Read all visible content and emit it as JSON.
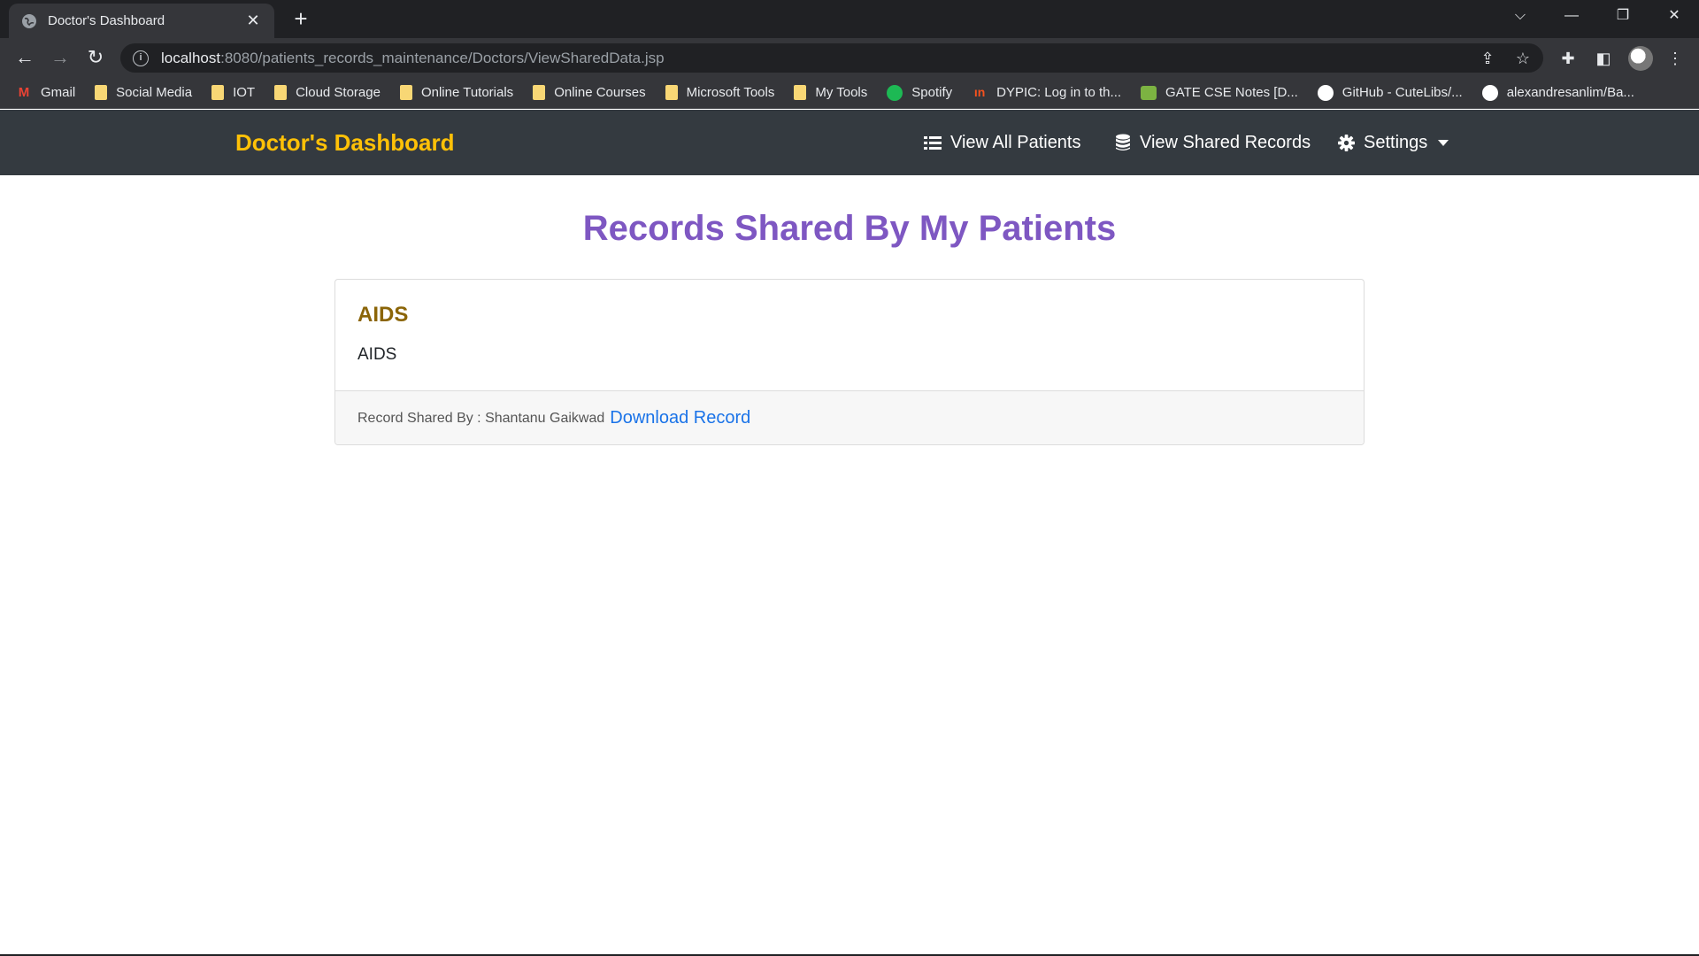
{
  "browser": {
    "tab_title": "Doctor's Dashboard",
    "url_host": "localhost",
    "url_rest": ":8080/patients_records_maintenance/Doctors/ViewSharedData.jsp",
    "bookmarks": [
      {
        "label": "Gmail",
        "icon": "gmail-icon"
      },
      {
        "label": "Social Media",
        "icon": "folder-icon"
      },
      {
        "label": "IOT",
        "icon": "folder-icon"
      },
      {
        "label": "Cloud Storage",
        "icon": "folder-icon"
      },
      {
        "label": "Online Tutorials",
        "icon": "folder-icon"
      },
      {
        "label": "Online Courses",
        "icon": "folder-icon"
      },
      {
        "label": "Microsoft Tools",
        "icon": "folder-icon"
      },
      {
        "label": "My Tools",
        "icon": "folder-icon"
      },
      {
        "label": "Spotify",
        "icon": "spotify-icon"
      },
      {
        "label": "DYPIC: Log in to th...",
        "icon": "dypic-icon"
      },
      {
        "label": "GATE CSE Notes [D...",
        "icon": "gate-icon"
      },
      {
        "label": "GitHub - CuteLibs/...",
        "icon": "github-icon"
      },
      {
        "label": "alexandresanlim/Ba...",
        "icon": "github-icon"
      }
    ]
  },
  "navbar": {
    "brand": "Doctor's Dashboard",
    "view_all_patients": "View All Patients",
    "view_shared_records": "View Shared Records",
    "settings": "Settings"
  },
  "main": {
    "title": "Records Shared By My Patients",
    "records": [
      {
        "title": "AIDS",
        "description": "AIDS",
        "shared_by_label": "Record Shared By : Shantanu Gaikwad",
        "download_label": "Download Record"
      }
    ]
  },
  "colors": {
    "brand": "#ffc107",
    "navbar_bg": "#343a40",
    "page_title": "#7e57c2",
    "card_title": "#8b6508",
    "link": "#1a73e8"
  }
}
